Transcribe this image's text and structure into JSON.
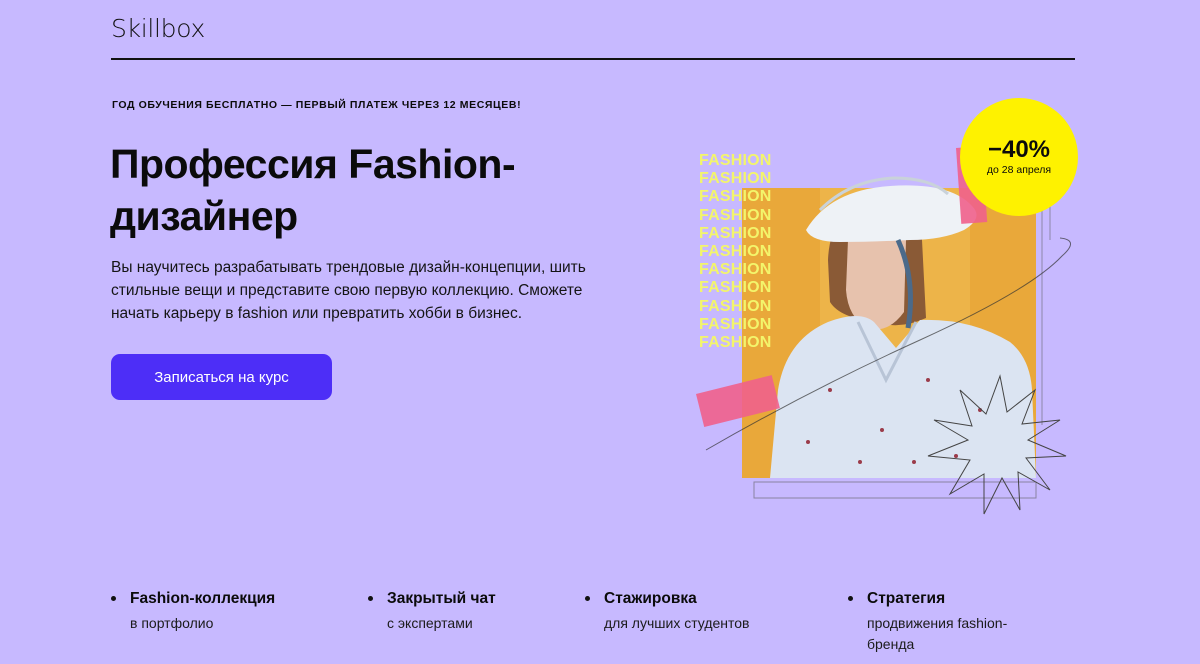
{
  "header": {
    "logo": "Skillbox"
  },
  "promo_text": "Год обучения бесплатно — первый платеж через 12 месяцев!",
  "hero": {
    "title": "Профессия Fashion-дизайнер",
    "description": "Вы научитесь разрабатывать трендовые дизайн-концепции, шить стильные вещи и представите свою первую коллекцию. Сможете начать карьеру в fashion или превратить хобби в бизнес.",
    "cta_label": "Записаться на курс"
  },
  "badge": {
    "value": "−40%",
    "date": "до 28 апреля"
  },
  "illustration": {
    "repeated_word": [
      "FASHION",
      "FASHION",
      "FASHION",
      "FASHION",
      "FASHION",
      "FASHION",
      "FASHION",
      "FASHION",
      "FASHION",
      "FASHION",
      "FASHION"
    ],
    "photo": "woman-in-white-hat-and-shirt"
  },
  "features": [
    {
      "title": "Fashion-коллекция",
      "subtitle": "в портфолио"
    },
    {
      "title": "Закрытый чат",
      "subtitle": "с экспертами"
    },
    {
      "title": "Стажировка",
      "subtitle": "для лучших студентов"
    },
    {
      "title": "Стратегия",
      "subtitle": "продвижения fashion-бренда"
    }
  ],
  "colors": {
    "background": "#c7b9ff",
    "button": "#4d2ef7",
    "badge": "#fef200",
    "accent_pink": "#f0608c",
    "photo_backdrop": "#e9a83a"
  }
}
